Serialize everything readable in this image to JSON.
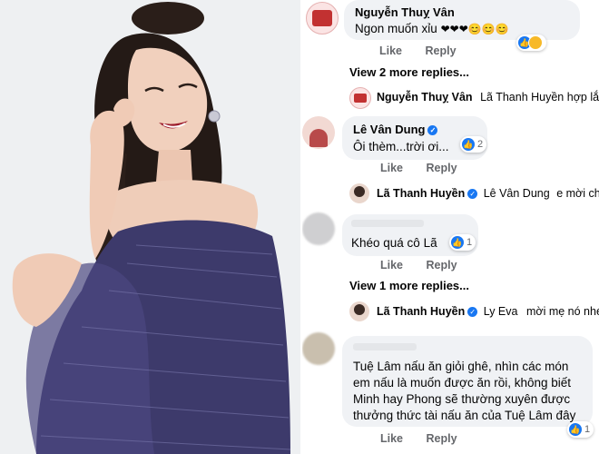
{
  "photo": {
    "description_icon": "portrait-photo",
    "colors": {
      "dress": "#3d3a6b",
      "background": "#eceef0"
    }
  },
  "comments": [
    {
      "author": "Nguyễn Thuỵ Vân",
      "text": "Ngon muốn xỉu",
      "emoji": "❤❤❤😊😊😊",
      "actions": [
        "Like",
        "Reply"
      ],
      "reaction_count": "",
      "more_replies": "View 2 more replies...",
      "reply": {
        "author": "Nguyễn Thuỵ Vân",
        "mention": "Lã Thanh Huyền",
        "text": "hợp lắm..."
      }
    },
    {
      "author": "Lê Vân Dung",
      "verified": true,
      "text": "Ôi thèm...trời ơi...",
      "reaction_count": "2",
      "actions": [
        "Like",
        "Reply"
      ],
      "reply": {
        "author": "Lã Thanh Huyền",
        "verified": true,
        "mention": "Lê Vân Dung",
        "text": "e mời chế"
      }
    },
    {
      "author": "",
      "text": "Khéo quá cô Lã",
      "reaction_count": "1",
      "actions": [
        "Like",
        "Reply"
      ],
      "more_replies": "View 1 more replies...",
      "reply": {
        "author": "Lã Thanh Huyền",
        "verified": true,
        "mention": "Ly Eva",
        "text": "mời mẹ nó nhé"
      }
    },
    {
      "author": "",
      "text_lines": [
        "Tuệ Lâm nấu ăn giỏi ghê, nhìn các món",
        "em nấu là muốn được ăn rồi, không biết",
        "Minh hay Phong sẽ thường xuyên được",
        "thưởng thức tài nấu ăn của Tuệ Lâm đây"
      ],
      "reaction_count": "1",
      "actions": [
        "Like",
        "Reply"
      ]
    }
  ],
  "accent": "#1877f2"
}
